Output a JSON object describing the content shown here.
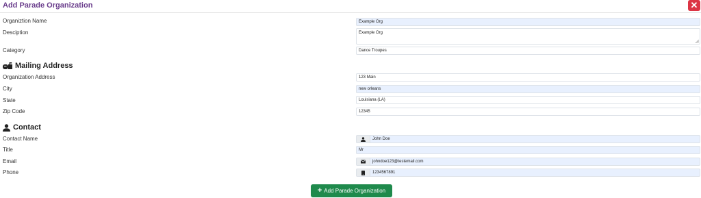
{
  "header": {
    "title": "Add Parade Organization",
    "close_symbol": "✕"
  },
  "organization": {
    "name_label": "Organiztion Name",
    "name_value": "Example Org",
    "description_label": "Desciption",
    "description_value": "Example Org",
    "category_label": "Category",
    "category_value": "Dance Troupes"
  },
  "mailing": {
    "section_title": "Mailing Address",
    "section_icon": "mailbox-icon",
    "address_label": "Organization Address",
    "address_value": "123 Main",
    "city_label": "City",
    "city_value": "new orleans",
    "state_label": "State",
    "state_value": "Louisiana (LA)",
    "zip_label": "Zip Code",
    "zip_value": "12345"
  },
  "contact": {
    "section_title": "Contact",
    "section_icon": "user-icon",
    "name_label": "Contact Name",
    "name_value": "John Doe",
    "name_icon": "user-icon",
    "title_label": "Title",
    "title_value": "Mr",
    "email_label": "Email",
    "email_value": "johndoe123@testemail.com",
    "email_icon": "envelope-icon",
    "phone_label": "Phone",
    "phone_value": "1234567891",
    "phone_icon": "phone-icon"
  },
  "submit": {
    "label": "Add Parade Organization",
    "icon": "plus-icon"
  },
  "colors": {
    "title": "#6a3d8c",
    "close": "#dc3545",
    "submit": "#1f8a4c",
    "field_highlight": "#e8f0fe"
  }
}
